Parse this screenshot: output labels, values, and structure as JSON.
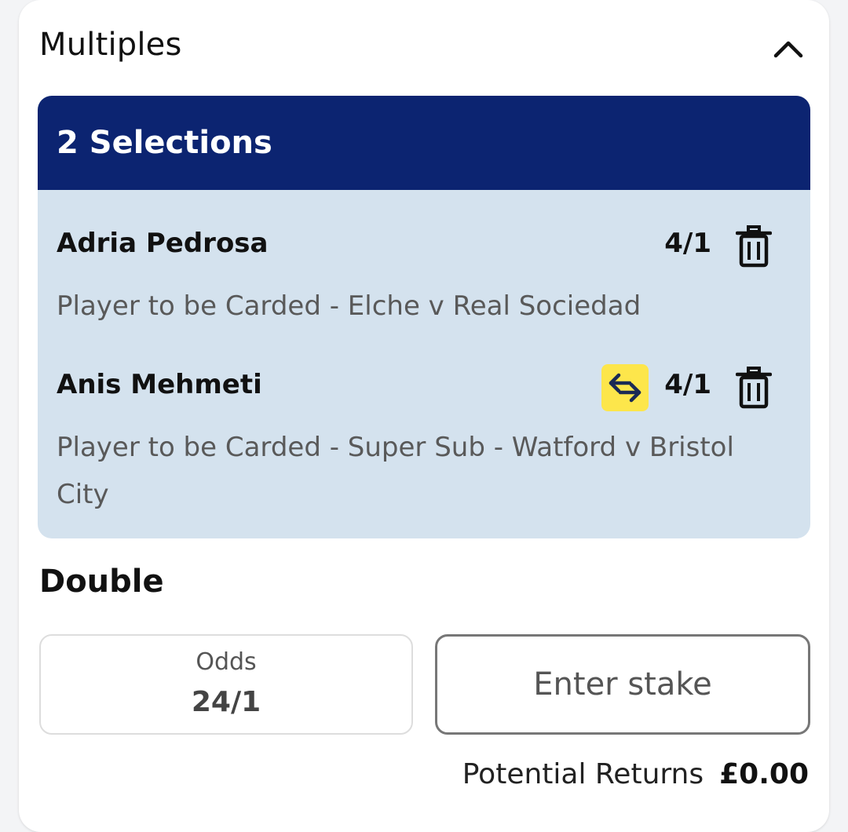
{
  "panel": {
    "title": "Multiples",
    "collapse_icon": "chevron-up-icon"
  },
  "selections": {
    "header": "2 Selections",
    "items": [
      {
        "name": "Adria Pedrosa",
        "odds": "4/1",
        "description": "Player to be Carded - Elche v Real Sociedad",
        "badge_icon": null
      },
      {
        "name": "Anis Mehmeti",
        "odds": "4/1",
        "description": "Player to be Carded - Super Sub - Watford v Bristol City",
        "badge_icon": "super-sub-swap-icon"
      }
    ]
  },
  "bet": {
    "type": "Double",
    "odds_label": "Odds",
    "odds_value": "24/1",
    "stake_placeholder": "Enter stake",
    "returns_label": "Potential Returns",
    "returns_value": "£0.00"
  },
  "colors": {
    "header_bg": "#0c2471",
    "selections_bg": "#d4e2ee",
    "badge_bg": "#fde64b"
  }
}
